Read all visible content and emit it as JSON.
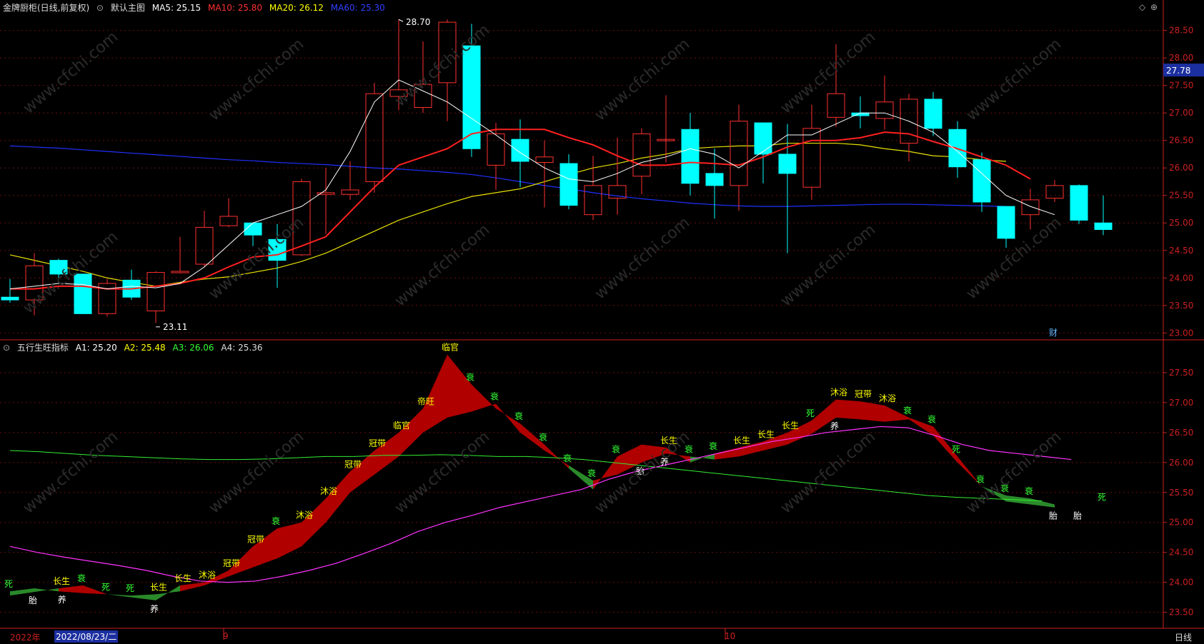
{
  "main": {
    "title": "金牌厨柜(日线,前复权)",
    "template": "默认主图",
    "ma_labels": [
      {
        "text": "MA5: 25.15",
        "color": "#ffffff"
      },
      {
        "text": "MA10: 25.80",
        "color": "#ff3030"
      },
      {
        "text": "MA20: 26.12",
        "color": "#ffff00"
      },
      {
        "text": "MA60: 25.30",
        "color": "#3040ff"
      }
    ],
    "price_ticks": [
      "28.50",
      "28.00",
      "27.50",
      "27.00",
      "26.50",
      "26.00",
      "25.50",
      "25.00",
      "24.50",
      "24.00",
      "23.50",
      "23.00"
    ],
    "current_price": "27.78",
    "high_label": "28.70",
    "low_label": "23.11",
    "marker": "财"
  },
  "indicator": {
    "title": "五行生旺指标",
    "labels": [
      {
        "text": "A1: 25.20",
        "color": "#ffffff"
      },
      {
        "text": "A2: 25.48",
        "color": "#ffff00"
      },
      {
        "text": "A3: 26.06",
        "color": "#33ff33"
      },
      {
        "text": "A4: 25.36",
        "color": "#dddddd"
      }
    ],
    "ticks": [
      "27.50",
      "27.00",
      "26.50",
      "26.00",
      "25.50",
      "25.00",
      "24.50",
      "24.00",
      "23.50"
    ]
  },
  "bottom": {
    "year": "2022年",
    "date": "2022/08/23/二",
    "month9": "9",
    "month10": "10",
    "period": "日线"
  },
  "colors": {
    "up": "#ff3030",
    "down": "#00ffff",
    "grid": "#661010",
    "axis": "#cc2020"
  },
  "chart_data": {
    "type": "candlestick",
    "price_range": [
      22.9,
      28.82
    ],
    "candles": [
      [
        23.65,
        23.6,
        23.98,
        23.55
      ],
      [
        23.6,
        24.22,
        24.45,
        23.32
      ],
      [
        24.32,
        24.07,
        24.35,
        23.9
      ],
      [
        24.07,
        23.35,
        24.07,
        23.35
      ],
      [
        23.35,
        23.9,
        23.98,
        23.3
      ],
      [
        23.96,
        23.65,
        24.15,
        23.6
      ],
      [
        23.4,
        24.1,
        24.12,
        23.18
      ],
      [
        24.1,
        24.12,
        24.75,
        24.08
      ],
      [
        24.25,
        24.92,
        25.22,
        24.2
      ],
      [
        24.95,
        25.12,
        25.45,
        24.92
      ],
      [
        25.0,
        24.78,
        25.0,
        24.58
      ],
      [
        24.7,
        24.32,
        24.98,
        23.82
      ],
      [
        24.42,
        25.75,
        25.8,
        24.4
      ],
      [
        25.52,
        25.55,
        26.0,
        24.8
      ],
      [
        25.52,
        25.6,
        26.12,
        25.42
      ],
      [
        25.75,
        27.35,
        27.55,
        25.55
      ],
      [
        27.3,
        27.42,
        28.7,
        27.05
      ],
      [
        27.1,
        27.52,
        28.3,
        27.0
      ],
      [
        27.55,
        28.65,
        28.7,
        26.85
      ],
      [
        28.22,
        26.35,
        28.62,
        26.2
      ],
      [
        26.05,
        26.62,
        26.82,
        25.6
      ],
      [
        26.52,
        26.12,
        26.88,
        25.65
      ],
      [
        26.1,
        26.2,
        26.5,
        25.28
      ],
      [
        26.08,
        25.32,
        26.25,
        25.25
      ],
      [
        25.15,
        25.68,
        26.22,
        25.05
      ],
      [
        25.45,
        25.68,
        26.55,
        25.15
      ],
      [
        25.85,
        26.62,
        26.72,
        25.52
      ],
      [
        26.52,
        26.52,
        27.32,
        26.1
      ],
      [
        26.7,
        25.72,
        27.0,
        25.5
      ],
      [
        25.9,
        25.68,
        26.35,
        25.08
      ],
      [
        25.68,
        26.85,
        27.15,
        25.22
      ],
      [
        26.82,
        26.25,
        26.8,
        25.72
      ],
      [
        26.25,
        25.9,
        26.8,
        24.45
      ],
      [
        25.65,
        26.72,
        27.15,
        25.42
      ],
      [
        26.92,
        27.35,
        28.25,
        26.75
      ],
      [
        27.0,
        26.95,
        27.3,
        26.72
      ],
      [
        26.9,
        27.2,
        27.68,
        26.7
      ],
      [
        26.45,
        27.25,
        27.35,
        26.12
      ],
      [
        27.25,
        26.72,
        27.38,
        26.58
      ],
      [
        26.7,
        26.02,
        26.85,
        25.82
      ],
      [
        26.15,
        25.38,
        26.28,
        25.2
      ],
      [
        25.3,
        24.72,
        25.28,
        24.55
      ],
      [
        25.15,
        25.42,
        25.62,
        24.88
      ],
      [
        25.45,
        25.68,
        25.78,
        25.38
      ],
      [
        25.68,
        25.05,
        25.7,
        24.98
      ],
      [
        25.0,
        24.88,
        25.5,
        24.78
      ]
    ],
    "ma5": [
      23.8,
      23.85,
      23.9,
      23.88,
      23.8,
      23.85,
      23.82,
      23.9,
      24.2,
      24.6,
      25.0,
      25.15,
      25.3,
      25.6,
      26.3,
      27.2,
      27.6,
      27.4,
      27.2,
      26.9,
      26.6,
      26.28,
      26.0,
      25.8,
      25.75,
      25.9,
      26.1,
      26.2,
      26.35,
      26.25,
      26.0,
      26.3,
      26.6,
      26.6,
      26.8,
      27.0,
      27.0,
      26.85,
      26.65,
      26.3,
      25.9,
      25.5,
      25.3,
      25.15
    ],
    "ma10": [
      23.8,
      23.8,
      23.85,
      23.85,
      23.8,
      23.8,
      23.85,
      23.9,
      24.0,
      24.2,
      24.38,
      24.42,
      24.58,
      24.75,
      25.2,
      25.65,
      26.05,
      26.2,
      26.35,
      26.62,
      26.7,
      26.7,
      26.7,
      26.55,
      26.42,
      26.22,
      26.05,
      26.05,
      26.1,
      26.08,
      26.05,
      26.2,
      26.38,
      26.5,
      26.5,
      26.55,
      26.65,
      26.62,
      26.48,
      26.35,
      26.2,
      26.05,
      25.8
    ],
    "ma20": [
      24.42,
      24.32,
      24.22,
      24.12,
      24.0,
      23.92,
      23.85,
      23.92,
      23.98,
      24.02,
      24.1,
      24.18,
      24.3,
      24.45,
      24.65,
      24.85,
      25.05,
      25.2,
      25.35,
      25.48,
      25.55,
      25.62,
      25.75,
      25.88,
      26.0,
      26.08,
      26.18,
      26.25,
      26.35,
      26.38,
      26.4,
      26.4,
      26.45,
      26.45,
      26.45,
      26.42,
      26.35,
      26.3,
      26.22,
      26.2,
      26.15,
      26.12
    ],
    "ma60": [
      26.4,
      26.38,
      26.36,
      26.33,
      26.3,
      26.27,
      26.24,
      26.21,
      26.18,
      26.15,
      26.13,
      26.1,
      26.08,
      26.06,
      26.03,
      26.0,
      25.98,
      25.95,
      25.92,
      25.88,
      25.82,
      25.75,
      25.68,
      25.62,
      25.55,
      25.49,
      25.44,
      25.4,
      25.36,
      25.33,
      25.31,
      25.3,
      25.3,
      25.31,
      25.32,
      25.33,
      25.34,
      25.34,
      25.33,
      25.32,
      25.31,
      25.3
    ],
    "ind_range": [
      23.4,
      27.88
    ],
    "a1": [
      23.78,
      23.84,
      23.9,
      23.95,
      23.8,
      23.75,
      23.7,
      23.95,
      24.0,
      24.2,
      24.6,
      24.9,
      25.0,
      25.4,
      25.85,
      26.2,
      26.5,
      26.9,
      27.8,
      27.3,
      26.9,
      26.65,
      26.3,
      25.9,
      25.55,
      26.1,
      26.3,
      26.25,
      26.0,
      26.15,
      26.25,
      26.35,
      26.5,
      26.7,
      27.05,
      27.02,
      26.95,
      26.75,
      26.6,
      26.1,
      25.6,
      25.35,
      25.3,
      25.25
    ],
    "a2": [
      23.85,
      23.9,
      23.85,
      23.82,
      23.8,
      23.78,
      23.8,
      23.85,
      23.95,
      24.1,
      24.25,
      24.4,
      24.6,
      25.0,
      25.5,
      25.8,
      26.1,
      26.5,
      26.75,
      26.85,
      26.98,
      26.5,
      26.2,
      25.95,
      25.7,
      25.8,
      26.0,
      26.15,
      26.1,
      26.05,
      26.1,
      26.2,
      26.3,
      26.48,
      26.75,
      26.72,
      26.68,
      26.72,
      26.45,
      26.0,
      25.6,
      25.45,
      25.4,
      25.3
    ],
    "a3": [
      26.2,
      26.18,
      26.15,
      26.12,
      26.1,
      26.08,
      26.06,
      26.05,
      26.05,
      26.06,
      26.08,
      26.1,
      26.1,
      26.12,
      26.12,
      26.13,
      26.12,
      26.1,
      26.1,
      26.08,
      26.05,
      26.0,
      25.95,
      25.9,
      25.85,
      25.8,
      25.75,
      25.7,
      25.65,
      25.6,
      25.55,
      25.5,
      25.45,
      25.42,
      25.4,
      25.38,
      25.36
    ],
    "a4": [
      24.6,
      24.5,
      24.42,
      24.35,
      24.28,
      24.2,
      24.1,
      24.02,
      24.0,
      24.02,
      24.1,
      24.2,
      24.32,
      24.48,
      24.65,
      24.85,
      25.0,
      25.12,
      25.25,
      25.35,
      25.45,
      25.55,
      25.72,
      25.85,
      25.95,
      26.05,
      26.15,
      26.25,
      26.35,
      26.42,
      26.5,
      26.55,
      26.6,
      26.58,
      26.45,
      26.3,
      26.2,
      26.15,
      26.1,
      26.05
    ],
    "phase_labels": [
      {
        "i": 0,
        "t": "死",
        "c": "#33ff33"
      },
      {
        "i": 1,
        "t": "胎",
        "c": "#ffffff"
      },
      {
        "i": 2,
        "t": "长生",
        "c": "#ffff00"
      },
      {
        "i": 2.2,
        "t": "养",
        "c": "#ffffff"
      },
      {
        "i": 3,
        "t": "衰",
        "c": "#33ff33"
      },
      {
        "i": 4,
        "t": "死",
        "c": "#33ff33"
      },
      {
        "i": 5,
        "t": "死",
        "c": "#33ff33"
      },
      {
        "i": 6,
        "t": "长生",
        "c": "#ffff00"
      },
      {
        "i": 6,
        "t": "养",
        "c": "#ffffff"
      },
      {
        "i": 7,
        "t": "长生",
        "c": "#ffff00"
      },
      {
        "i": 8,
        "t": "沐浴",
        "c": "#ffff00"
      },
      {
        "i": 9,
        "t": "冠带",
        "c": "#ffff00"
      },
      {
        "i": 10,
        "t": "冠带",
        "c": "#ffff00"
      },
      {
        "i": 11,
        "t": "衰",
        "c": "#33ff33"
      },
      {
        "i": 12,
        "t": "沐浴",
        "c": "#ffff00"
      },
      {
        "i": 13,
        "t": "沐浴",
        "c": "#ffff00"
      },
      {
        "i": 14,
        "t": "冠带",
        "c": "#ffff00"
      },
      {
        "i": 15,
        "t": "冠带",
        "c": "#ffff00"
      },
      {
        "i": 16,
        "t": "临官",
        "c": "#ffff00"
      },
      {
        "i": 17,
        "t": "帝旺",
        "c": "#ffff00"
      },
      {
        "i": 18,
        "t": "临官",
        "c": "#ffff00"
      },
      {
        "i": 19,
        "t": "衰",
        "c": "#33ff33"
      },
      {
        "i": 20,
        "t": "衰",
        "c": "#33ff33"
      },
      {
        "i": 21,
        "t": "衰",
        "c": "#33ff33"
      },
      {
        "i": 22,
        "t": "衰",
        "c": "#33ff33"
      },
      {
        "i": 23,
        "t": "衰",
        "c": "#33ff33"
      },
      {
        "i": 24,
        "t": "衰",
        "c": "#33ff33"
      },
      {
        "i": 25,
        "t": "衰",
        "c": "#33ff33"
      },
      {
        "i": 26,
        "t": "胎",
        "c": "#ffffff"
      },
      {
        "i": 27,
        "t": "长生",
        "c": "#ffff00"
      },
      {
        "i": 27,
        "t": "养",
        "c": "#ffffff"
      },
      {
        "i": 28,
        "t": "衰",
        "c": "#33ff33"
      },
      {
        "i": 29,
        "t": "衰",
        "c": "#33ff33"
      },
      {
        "i": 30,
        "t": "长生",
        "c": "#ffff00"
      },
      {
        "i": 31,
        "t": "长生",
        "c": "#ffff00"
      },
      {
        "i": 32,
        "t": "长生",
        "c": "#ffff00"
      },
      {
        "i": 33,
        "t": "死",
        "c": "#33ff33"
      },
      {
        "i": 34,
        "t": "沐浴",
        "c": "#ffff00"
      },
      {
        "i": 34,
        "t": "养",
        "c": "#ffffff"
      },
      {
        "i": 35,
        "t": "冠带",
        "c": "#ffff00"
      },
      {
        "i": 36,
        "t": "沐浴",
        "c": "#ffff00"
      },
      {
        "i": 37,
        "t": "衰",
        "c": "#33ff33"
      },
      {
        "i": 38,
        "t": "衰",
        "c": "#33ff33"
      },
      {
        "i": 39,
        "t": "死",
        "c": "#33ff33"
      },
      {
        "i": 40,
        "t": "衰",
        "c": "#33ff33"
      },
      {
        "i": 41,
        "t": "衰",
        "c": "#33ff33"
      },
      {
        "i": 42,
        "t": "衰",
        "c": "#33ff33"
      },
      {
        "i": 43,
        "t": "胎",
        "c": "#ffffff"
      },
      {
        "i": 44,
        "t": "胎",
        "c": "#ffffff"
      },
      {
        "i": 45,
        "t": "死",
        "c": "#33ff33"
      }
    ]
  }
}
